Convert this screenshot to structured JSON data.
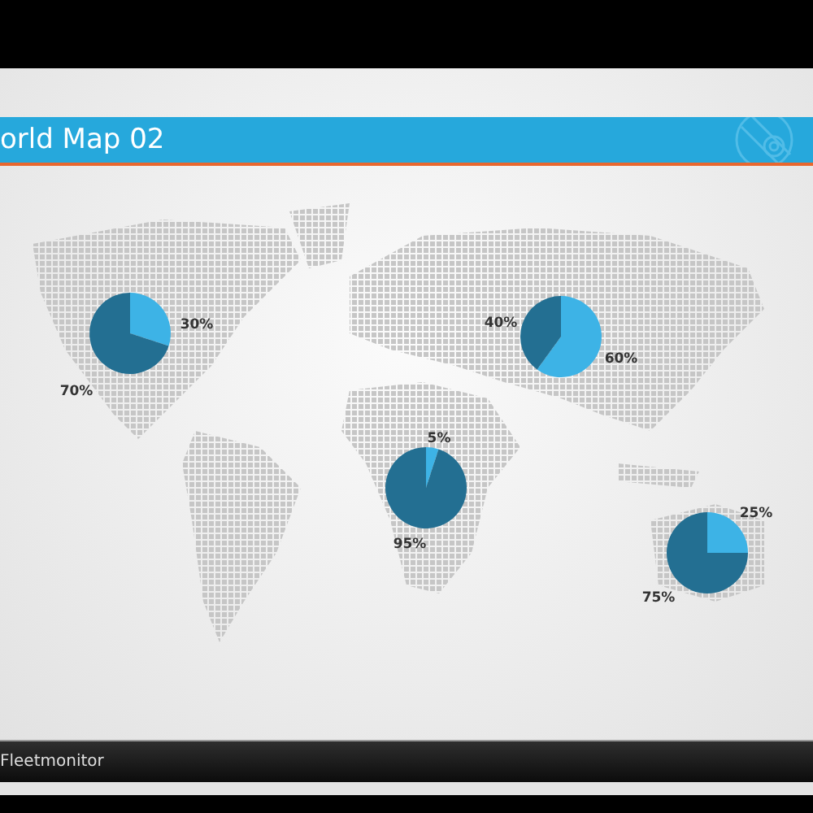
{
  "title_bar": {
    "title": "orld Map 02"
  },
  "map": {
    "pies": [
      {
        "chart_data": {
          "type": "pie",
          "values": [
            30,
            70
          ],
          "value_labels": [
            "30%",
            "70%"
          ]
        }
      },
      {
        "chart_data": {
          "type": "pie",
          "values": [
            60,
            40
          ],
          "value_labels": [
            "60%",
            "40%"
          ]
        }
      },
      {
        "chart_data": {
          "type": "pie",
          "values": [
            5,
            95
          ],
          "value_labels": [
            "5%",
            "95%"
          ]
        }
      },
      {
        "chart_data": {
          "type": "pie",
          "values": [
            25,
            75
          ],
          "value_labels": [
            "25%",
            "75%"
          ]
        }
      }
    ]
  },
  "footer": {
    "brand": "Fleetmonitor"
  }
}
